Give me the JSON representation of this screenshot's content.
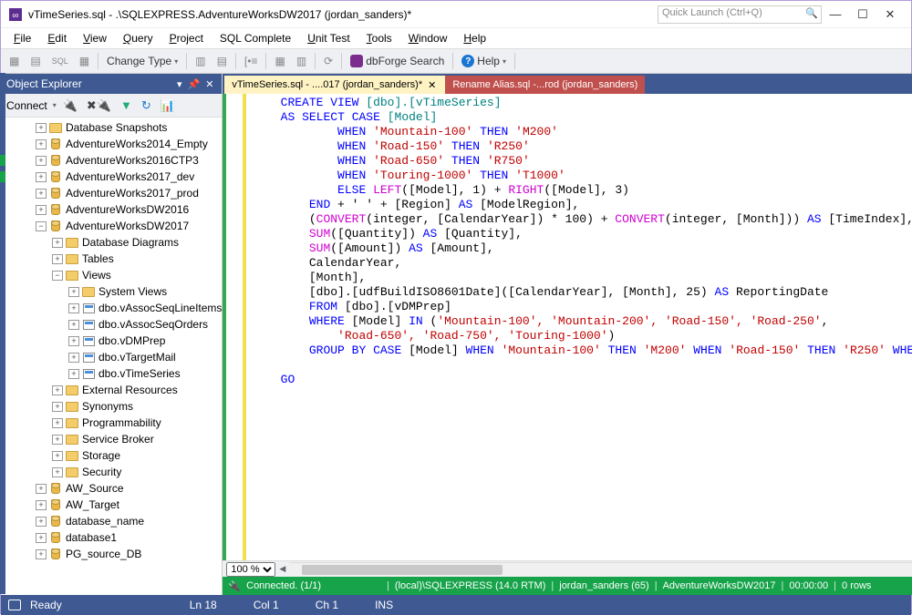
{
  "title": "vTimeSeries.sql - .\\SQLEXPRESS.AdventureWorksDW2017 (jordan_sanders)*",
  "quick_launch_placeholder": "Quick Launch (Ctrl+Q)",
  "menus": [
    "File",
    "Edit",
    "View",
    "Query",
    "Project",
    "SQL Complete",
    "Unit Test",
    "Tools",
    "Window",
    "Help"
  ],
  "toolbar": {
    "change_type": "Change Type",
    "dbforge": "dbForge Search",
    "help": "Help"
  },
  "object_explorer": {
    "title": "Object Explorer",
    "connect": "Connect",
    "databases": [
      "Database Snapshots",
      "AdventureWorks2014_Empty",
      "AdventureWorks2016CTP3",
      "AdventureWorks2017_dev",
      "AdventureWorks2017_prod",
      "AdventureWorksDW2016",
      "AdventureWorksDW2017"
    ],
    "dw2017_children": [
      "Database Diagrams",
      "Tables",
      "Views"
    ],
    "views_children": [
      "System Views",
      "dbo.vAssocSeqLineItems",
      "dbo.vAssocSeqOrders",
      "dbo.vDMPrep",
      "dbo.vTargetMail",
      "dbo.vTimeSeries"
    ],
    "dw2017_more": [
      "External Resources",
      "Synonyms",
      "Programmability",
      "Service Broker",
      "Storage",
      "Security"
    ],
    "more_dbs": [
      "AW_Source",
      "AW_Target",
      "database_name",
      "database1",
      "PG_source_DB"
    ]
  },
  "tabs": {
    "active": "vTimeSeries.sql - ....017 (jordan_sanders)*",
    "inactive": "Rename Alias.sql -...rod (jordan_sanders)"
  },
  "code_tokens": {
    "create_view": "CREATE VIEW",
    "dbo_vtimeseries": "[dbo].[vTimeSeries]",
    "as": "AS",
    "select": "SELECT",
    "case": "CASE",
    "model": "[Model]",
    "when": "WHEN",
    "then": "THEN",
    "mountain100": "'Mountain-100'",
    "m200": "'M200'",
    "road150": "'Road-150'",
    "r250": "'R250'",
    "road650": "'Road-650'",
    "r750": "'R750'",
    "touring1000": "'Touring-1000'",
    "t1000": "'T1000'",
    "else": "ELSE",
    "left": "LEFT",
    "right": "RIGHT",
    "model_1": "([Model], 1)",
    "model_3": "([Model], 3)",
    "plus": " + ",
    "end": "END",
    "region_alias": " + ' ' + [Region] ",
    "as_kw": "AS",
    "modelregion": " [ModelRegion],",
    "convert": "CONVERT",
    "convert_cy": "(integer, [CalendarYear]) * 100) + ",
    "convert_m": "(integer, [Month]))",
    "timeindex": " [TimeIndex],",
    "sum": "SUM",
    "qty": "([Quantity]) ",
    "qty_alias": " [Quantity],",
    "amt": "([Amount]) ",
    "amt_alias": " [Amount],",
    "calendaryear": "CalendarYear,",
    "month": "[Month],",
    "udf": "[dbo].[udfBuildISO8601Date]([CalendarYear], [Month], 25) ",
    "reportingdate": " ReportingDate",
    "from": "FROM",
    "vdmprep": " [dbo].[vDMPrep]",
    "where": "WHERE",
    "in": "IN",
    "in_list1": "'Mountain-100', 'Mountain-200', 'Road-150', 'Road-250'",
    "in_list2": "'Road-650', 'Road-750', 'Touring-1000'",
    "group_by": "GROUP BY",
    "go": "GO",
    "road_trunc": "'Road"
  },
  "zoom": "100 %",
  "conn": {
    "status": "Connected. (1/1)",
    "server": "(local)\\SQLEXPRESS (14.0 RTM)",
    "user": "jordan_sanders (65)",
    "db": "AdventureWorksDW2017",
    "time": "00:00:00",
    "rows": "0 rows"
  },
  "status": {
    "ready": "Ready",
    "ln": "Ln 18",
    "col": "Col 1",
    "ch": "Ch 1",
    "ins": "INS"
  }
}
